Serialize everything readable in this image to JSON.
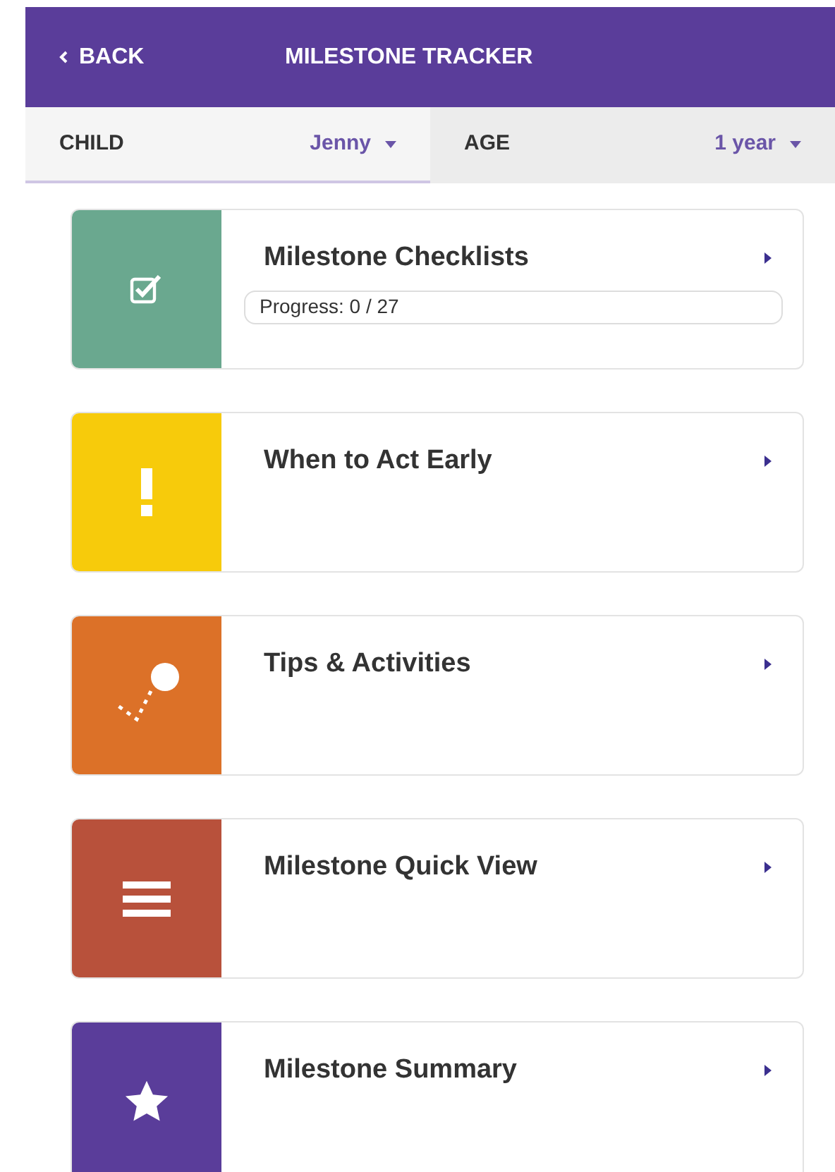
{
  "header": {
    "back": "BACK",
    "title": "MILESTONE TRACKER"
  },
  "selectors": [
    {
      "label": "CHILD",
      "value": "Jenny",
      "selected": true
    },
    {
      "label": "AGE",
      "value": "1 year",
      "selected": false
    }
  ],
  "cards": [
    {
      "title": "Milestone Checklists",
      "kind": "checklist",
      "color": "#6aa88f",
      "progress": {
        "text": "Progress: 0 / 27",
        "level": 0
      }
    },
    {
      "title": "When to Act Early",
      "kind": "alert",
      "color": "#f7cb0b"
    },
    {
      "title": "Tips & Activities",
      "kind": "tips",
      "color": "#dc7128"
    },
    {
      "title": "Milestone Quick View",
      "kind": "list",
      "color": "#b8513b"
    },
    {
      "title": "Milestone Summary",
      "kind": "star",
      "color": "#5a3d9a"
    }
  ]
}
